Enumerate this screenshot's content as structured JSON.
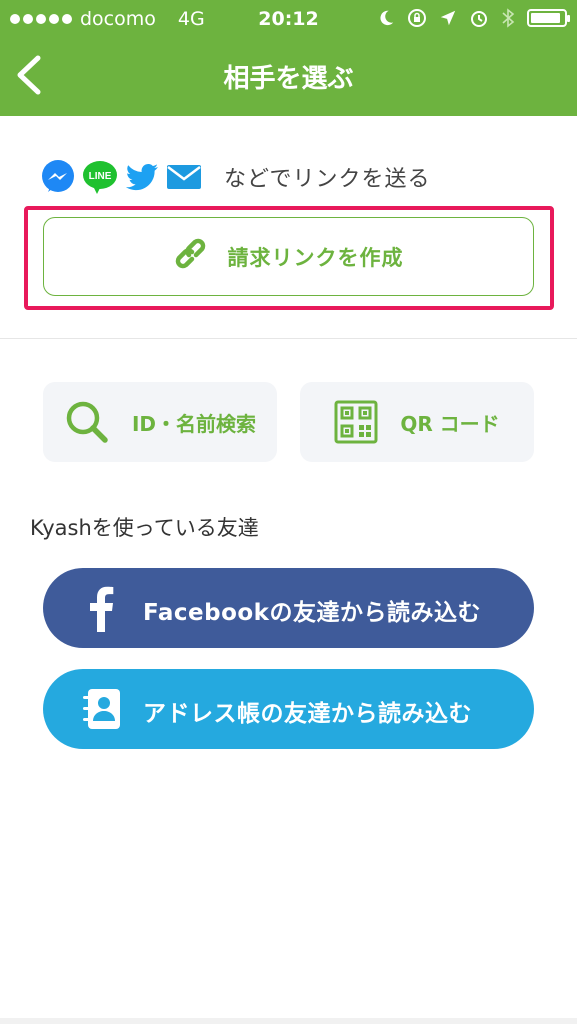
{
  "status_bar": {
    "carrier": "docomo",
    "network": "4G",
    "time": "20:12",
    "signal_bars": 5,
    "battery_level": 0.9
  },
  "nav": {
    "title": "相手を選ぶ",
    "back_icon": "chevron-left-icon"
  },
  "share": {
    "icons": [
      "messenger-icon",
      "line-icon",
      "twitter-icon",
      "mail-icon"
    ],
    "line_icon_text": "LINE",
    "text": "などでリンクを送る"
  },
  "create_link": {
    "label": "請求リンクを作成",
    "icon": "link-icon"
  },
  "search_tiles": [
    {
      "label": "ID・名前検索",
      "icon": "search-icon"
    },
    {
      "label": "QR コード",
      "icon": "qr-code-icon"
    }
  ],
  "friends_section": {
    "title": "Kyashを使っている友達"
  },
  "import_buttons": [
    {
      "label": "Facebookの友達から読み込む",
      "icon": "facebook-icon"
    },
    {
      "label": "アドレス帳の友達から読み込む",
      "icon": "address-book-icon"
    }
  ],
  "colors": {
    "brand_green": "#6db33f",
    "highlight_red": "#e8195b",
    "facebook_blue": "#3f5b9a",
    "addressbook_blue": "#25a9df",
    "tile_bg": "#f3f5f8"
  }
}
